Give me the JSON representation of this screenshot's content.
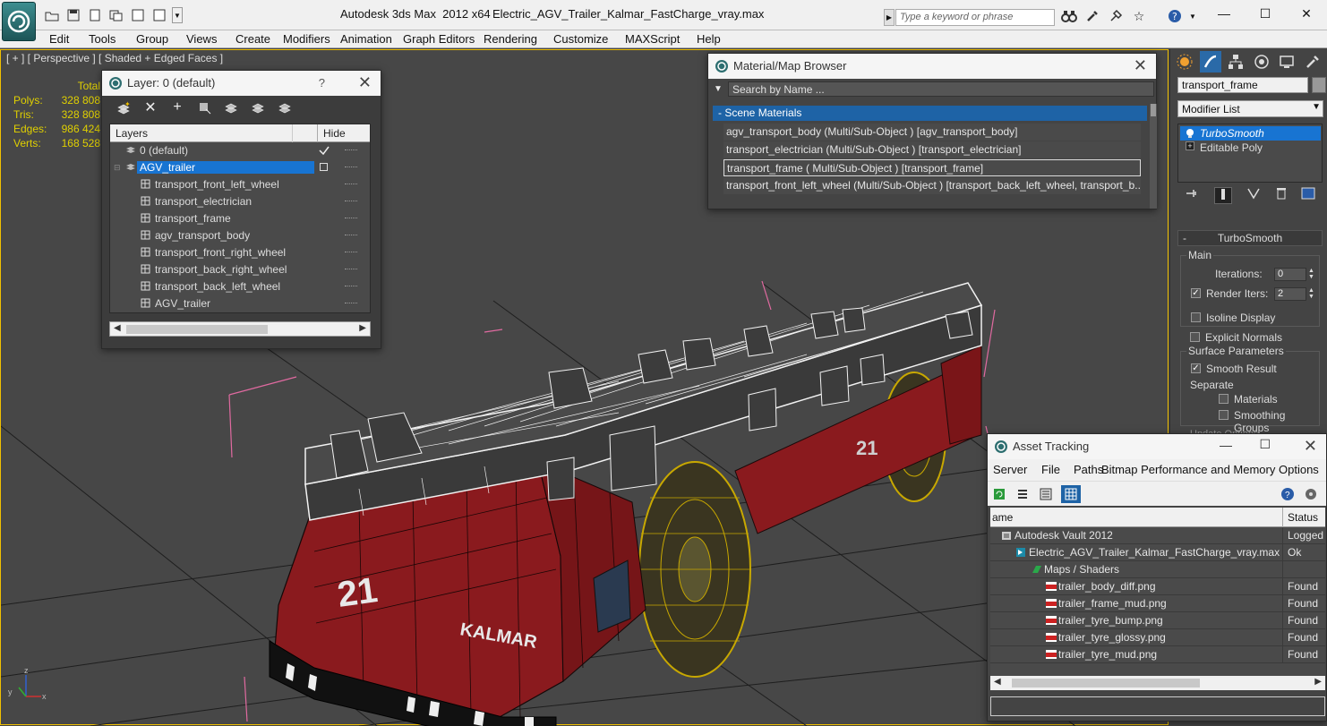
{
  "titlebar": {
    "app_title": "Autodesk 3ds Max  2012 x64",
    "file_title": "Electric_AGV_Trailer_Kalmar_FastCharge_vray.max",
    "search_placeholder": "Type a keyword or phrase",
    "minimize": "—",
    "maximize": "☐",
    "close": "✕"
  },
  "menu": [
    "Edit",
    "Tools",
    "Group",
    "Views",
    "Create",
    "Modifiers",
    "Animation",
    "Graph Editors",
    "Rendering",
    "Customize",
    "MAXScript",
    "Help"
  ],
  "viewport": {
    "label": "[ + ] [ Perspective ] [ Shaded + Edged Faces ]",
    "stats": {
      "header": "Total",
      "rows": [
        {
          "label": "Polys:",
          "value": "328 808"
        },
        {
          "label": "Tris:",
          "value": "328 808"
        },
        {
          "label": "Edges:",
          "value": "986 424"
        },
        {
          "label": "Verts:",
          "value": "168 528"
        }
      ]
    },
    "model_text": {
      "number": "21",
      "brand": "KALMAR"
    },
    "axis": {
      "x": "x",
      "y": "y",
      "z": "z"
    }
  },
  "layer_dialog": {
    "title": "Layer: 0 (default)",
    "help": "?",
    "close": "✕",
    "col_layers": "Layers",
    "col_hide": "Hide",
    "rows": [
      {
        "name": "0 (default)",
        "indent": 1,
        "type": "layer",
        "current": true
      },
      {
        "name": "AGV_trailer",
        "indent": 1,
        "type": "layer",
        "selected": true
      },
      {
        "name": "transport_front_left_wheel",
        "indent": 2,
        "type": "object"
      },
      {
        "name": "transport_electrician",
        "indent": 2,
        "type": "object"
      },
      {
        "name": "transport_frame",
        "indent": 2,
        "type": "object"
      },
      {
        "name": "agv_transport_body",
        "indent": 2,
        "type": "object"
      },
      {
        "name": "transport_front_right_wheel",
        "indent": 2,
        "type": "object"
      },
      {
        "name": "transport_back_right_wheel",
        "indent": 2,
        "type": "object"
      },
      {
        "name": "transport_back_left_wheel",
        "indent": 2,
        "type": "object"
      },
      {
        "name": "AGV_trailer",
        "indent": 2,
        "type": "object"
      }
    ]
  },
  "material_browser": {
    "title": "Material/Map Browser",
    "close": "✕",
    "search_placeholder": "Search by Name ...",
    "section": "- Scene Materials",
    "items": [
      "agv_transport_body  (Multi/Sub-Object ) [agv_transport_body]",
      "transport_electrician  (Multi/Sub-Object ) [transport_electrician]",
      "transport_frame  ( Multi/Sub-Object ) [transport_frame]",
      "transport_front_left_wheel  (Multi/Sub-Object ) [transport_back_left_wheel, transport_b..."
    ],
    "selected_index": 2
  },
  "command_panel": {
    "object_name": "transport_frame",
    "modifier_list": "Modifier List",
    "stack": [
      "TurboSmooth",
      "Editable Poly"
    ],
    "turbosmooth": {
      "title": "TurboSmooth",
      "main": "Main",
      "iterations_label": "Iterations:",
      "iterations": "0",
      "render_iters_label": "Render Iters:",
      "render_iters": "2",
      "isoline": "Isoline Display",
      "explicit": "Explicit Normals",
      "surface": "Surface Parameters",
      "smooth_result": "Smooth Result",
      "separate": "Separate",
      "materials": "Materials",
      "smoothing_groups": "Smoothing Groups",
      "update_options": "Update Options"
    }
  },
  "asset_tracking": {
    "title": "Asset Tracking",
    "menu": [
      "Server",
      "File",
      "Paths",
      "Bitmap Performance and Memory",
      "Options"
    ],
    "col_name": "ame",
    "col_status": "Status",
    "rows": [
      {
        "name": "Autodesk Vault 2012",
        "status": "Logged",
        "indent": 0,
        "icon": "vault"
      },
      {
        "name": "Electric_AGV_Trailer_Kalmar_FastCharge_vray.max",
        "status": "Ok",
        "indent": 1,
        "icon": "max"
      },
      {
        "name": "Maps / Shaders",
        "status": "",
        "indent": 2,
        "icon": "maps"
      },
      {
        "name": "trailer_body_diff.png",
        "status": "Found",
        "indent": 3,
        "icon": "png"
      },
      {
        "name": "trailer_frame_mud.png",
        "status": "Found",
        "indent": 3,
        "icon": "png"
      },
      {
        "name": "trailer_tyre_bump.png",
        "status": "Found",
        "indent": 3,
        "icon": "png"
      },
      {
        "name": "trailer_tyre_glossy.png",
        "status": "Found",
        "indent": 3,
        "icon": "png"
      },
      {
        "name": "trailer_tyre_mud.png",
        "status": "Found",
        "indent": 3,
        "icon": "png"
      }
    ]
  },
  "colors": {
    "viewport_bg": "#474747",
    "selection_blue": "#1874d2",
    "stats_yellow": "#e0d000",
    "body_red": "#8a1a1e",
    "wheel_yellow": "#c8a800"
  }
}
